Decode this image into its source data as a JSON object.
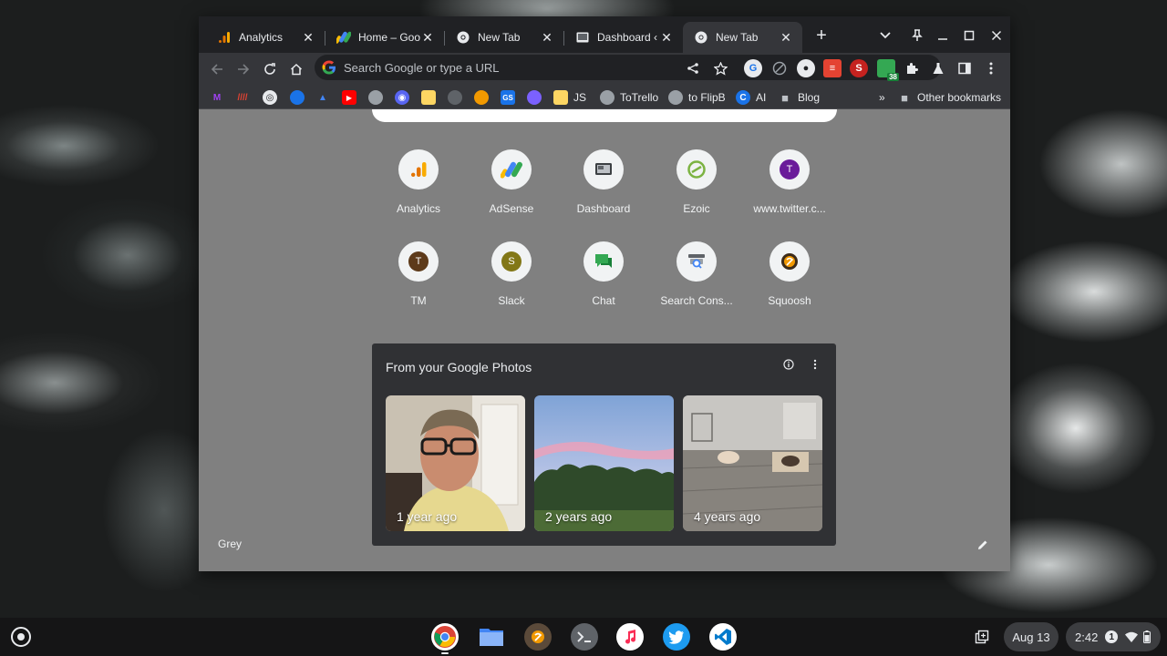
{
  "browser": {
    "tabs": [
      {
        "title": "Analytics",
        "icon": "analytics-icon",
        "active": false
      },
      {
        "title": "Home – Google",
        "icon": "adsense-icon",
        "active": false
      },
      {
        "title": "New Tab",
        "icon": "chrome-icon",
        "active": false
      },
      {
        "title": "Dashboard ‹ AI",
        "icon": "dashboard-icon",
        "active": false
      },
      {
        "title": "New Tab",
        "icon": "chrome-icon",
        "active": true
      }
    ],
    "new_tab_symbol": "+",
    "omnibox": {
      "placeholder": "Search Google or type a URL",
      "value": ""
    },
    "bookmarks": [
      {
        "label": "JS"
      },
      {
        "label": "ToTrello"
      },
      {
        "label": "to FlipB"
      },
      {
        "label": "AI"
      },
      {
        "label": "Blog"
      }
    ],
    "overflow_symbol": "»",
    "other_bookmarks": "Other bookmarks",
    "extension_badge": "38"
  },
  "ntp": {
    "shortcuts": [
      {
        "label": "Analytics",
        "letter": ""
      },
      {
        "label": "AdSense",
        "letter": ""
      },
      {
        "label": "Dashboard",
        "letter": ""
      },
      {
        "label": "Ezoic",
        "letter": ""
      },
      {
        "label": "www.twitter.c...",
        "letter": "T"
      },
      {
        "label": "TM",
        "letter": "T"
      },
      {
        "label": "Slack",
        "letter": "S"
      },
      {
        "label": "Chat",
        "letter": ""
      },
      {
        "label": "Search Cons...",
        "letter": ""
      },
      {
        "label": "Squoosh",
        "letter": ""
      }
    ],
    "photos_card": {
      "title": "From your Google Photos",
      "photos": [
        {
          "caption": "1 year ago"
        },
        {
          "caption": "2 years ago"
        },
        {
          "caption": "4 years ago"
        }
      ]
    },
    "theme_label": "Grey"
  },
  "shelf": {
    "apps": [
      "chrome-icon",
      "files-icon",
      "squoosh-icon",
      "terminal-icon",
      "music-icon",
      "twitter-icon",
      "vscode-icon"
    ],
    "date": "Aug 13",
    "time": "2:42",
    "notification_count": "1"
  },
  "colors": {
    "ntp_background": "#808080",
    "tab_strip": "#202124",
    "toolbar": "#35363a",
    "card": "#303134"
  }
}
